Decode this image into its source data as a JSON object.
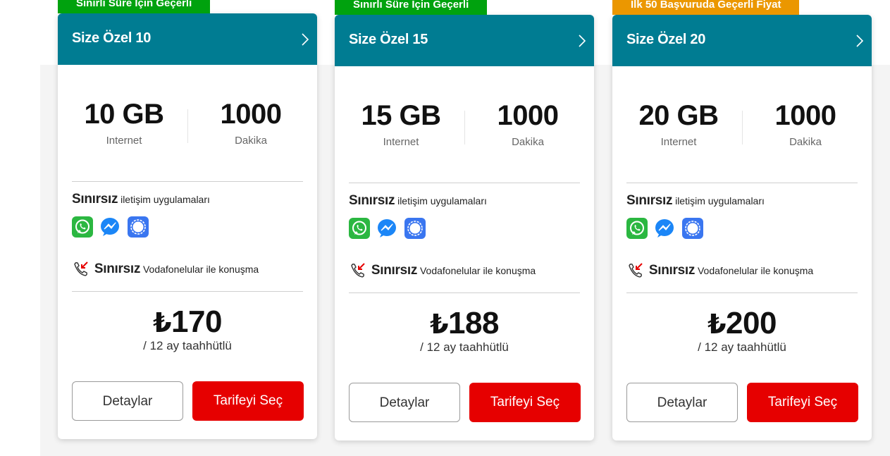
{
  "cards": [
    {
      "ribbon": "Sınırlı Süre İçin Geçerli",
      "ribbon_color": "#00a20e",
      "title": "Size Özel 10",
      "data_value": "10 GB",
      "data_label": "Internet",
      "minutes_value": "1000",
      "minutes_label": "Dakika",
      "unlimited_strong": "Sınırsız",
      "unlimited_text": "iletişim uygulamaları",
      "apps": [
        "whatsapp-icon",
        "messenger-icon",
        "signal-icon"
      ],
      "call_strong": "Sınırsız",
      "call_text": "Vodafonelular ile konuşma",
      "currency": "₺",
      "price": "170",
      "term": "/ 12 ay taahhütlü",
      "details_label": "Detaylar",
      "select_label": "Tarifeyi Seç"
    },
    {
      "ribbon": "Sınırlı Süre İçin Geçerli",
      "ribbon_color": "#00a20e",
      "title": "Size Özel 15",
      "data_value": "15 GB",
      "data_label": "Internet",
      "minutes_value": "1000",
      "minutes_label": "Dakika",
      "unlimited_strong": "Sınırsız",
      "unlimited_text": "iletişim uygulamaları",
      "apps": [
        "whatsapp-icon",
        "messenger-icon",
        "signal-icon"
      ],
      "call_strong": "Sınırsız",
      "call_text": "Vodafonelular ile konuşma",
      "currency": "₺",
      "price": "188",
      "term": "/ 12 ay taahhütlü",
      "details_label": "Detaylar",
      "select_label": "Tarifeyi Seç"
    },
    {
      "ribbon": "İlk 50 Başvuruda Geçerli Fiyat",
      "ribbon_color": "#eb9700",
      "title": "Size Özel 20",
      "data_value": "20 GB",
      "data_label": "Internet",
      "minutes_value": "1000",
      "minutes_label": "Dakika",
      "unlimited_strong": "Sınırsız",
      "unlimited_text": "iletişim uygulamaları",
      "apps": [
        "whatsapp-icon",
        "messenger-icon",
        "signal-icon"
      ],
      "call_strong": "Sınırsız",
      "call_text": "Vodafonelular ile konuşma",
      "currency": "₺",
      "price": "200",
      "term": "/ 12 ay taahhütlü",
      "details_label": "Detaylar",
      "select_label": "Tarifeyi Seç"
    }
  ],
  "colors": {
    "header": "#007c92",
    "primary_button": "#e60000",
    "panel_bg": "#f4f4f4"
  }
}
